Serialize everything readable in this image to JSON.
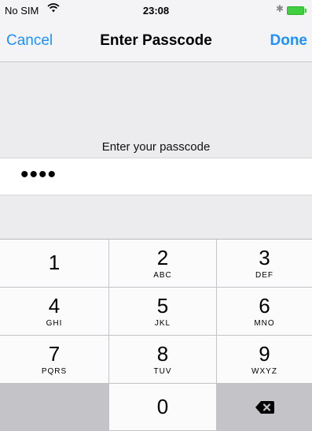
{
  "status_bar": {
    "carrier": "No SIM",
    "time": "23:08",
    "wifi_icon": "wifi-icon",
    "bluetooth_icon": "bluetooth-icon",
    "battery_icon": "battery-icon",
    "battery_color": "#41cf41"
  },
  "nav": {
    "cancel_label": "Cancel",
    "title": "Enter Passcode",
    "done_label": "Done",
    "accent_color": "#1e90ff"
  },
  "passcode": {
    "prompt": "Enter your passcode",
    "masked_value": "••••"
  },
  "keypad": {
    "keys": [
      {
        "digit": "1",
        "letters": ""
      },
      {
        "digit": "2",
        "letters": "ABC"
      },
      {
        "digit": "3",
        "letters": "DEF"
      },
      {
        "digit": "4",
        "letters": "GHI"
      },
      {
        "digit": "5",
        "letters": "JKL"
      },
      {
        "digit": "6",
        "letters": "MNO"
      },
      {
        "digit": "7",
        "letters": "PQRS"
      },
      {
        "digit": "8",
        "letters": "TUV"
      },
      {
        "digit": "9",
        "letters": "WXYZ"
      },
      {
        "digit": "0",
        "letters": ""
      }
    ],
    "delete_icon": "backspace-icon"
  }
}
